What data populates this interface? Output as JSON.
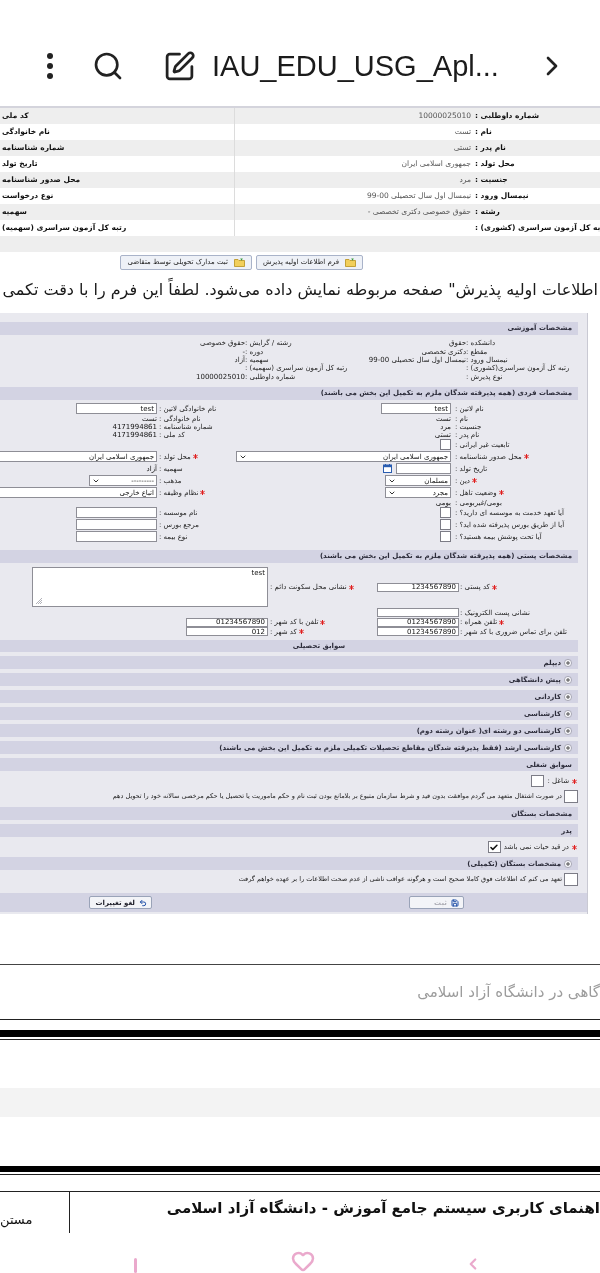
{
  "toolbar": {
    "title": "IAU_EDU_USG_Apl..."
  },
  "summary": {
    "rows": [
      {
        "label": "شماره داوطلبی :",
        "value": "10000025010",
        "side_label": "کد ملی"
      },
      {
        "label": "نام :",
        "value": "تست",
        "side_label": "نام خانوادگی"
      },
      {
        "label": "نام پدر :",
        "value": "تستی",
        "side_label": "شماره شناسنامه"
      },
      {
        "label": "محل تولد :",
        "value": "جمهوری اسلامی ایران",
        "side_label": "تاریخ تولد"
      },
      {
        "label": "جنسیت :",
        "value": "مرد",
        "side_label": "محل صدور شناسنامه"
      },
      {
        "label": "نیمسال ورود :",
        "value": "نیمسال اول سال تحصیلی 00-99",
        "side_label": "نوع درخواست"
      },
      {
        "label": "رشته :",
        "value": "حقوق خصوصی دکتری تخصصی -",
        "side_label": "سهمیه"
      },
      {
        "label": "به کل آزمون سراسری (کشوری) :",
        "side_label": "رتبه کل آزمون سراسری (سهمیه)"
      }
    ]
  },
  "actions": [
    {
      "label": "فرم اطلاعات اولیه پذیرش"
    },
    {
      "label": "ثبت مدارک تحویلی توسط متقاضی"
    }
  ],
  "instruction": "اطلاعات اولیه پذیرش\" صفحه مربوطه نمایش داده می‌شود. لطفاً این فرم را با دقت تکمی",
  "form": {
    "blocks": [
      {
        "kind": "section",
        "label": "مشخصات آموزشی"
      },
      {
        "kind": "info",
        "right": [
          {
            "label": "دانشکده :",
            "value": "حقوق"
          },
          {
            "label": "مقطع :",
            "value": "دکتری تخصصی"
          },
          {
            "label": "نیمسال ورود :",
            "value": "نیمسال اول سال تحصیلی 00-99"
          },
          {
            "label": "رتبه کل آزمون سراسری(کشوری) :"
          },
          {
            "label": "نوع پذیرش :"
          }
        ],
        "left": [
          {
            "label": "رشته / گرایش :",
            "value": "حقوق خصوصی"
          },
          {
            "label": "دوره :",
            "value": "-"
          },
          {
            "label": "سهمیه :",
            "value": "آزاد"
          },
          {
            "label": "رتبه کل آزمون سراسری (سهمیه) :"
          },
          {
            "label": "شماره داوطلبی :",
            "value": "10000025010"
          }
        ]
      },
      {
        "kind": "section",
        "label": "مشخصات فردی (همه پذیرفته شدگان ملزم به تکمیل این بخش می باشند)"
      },
      {
        "kind": "fields",
        "rows": [
          {
            "right": {
              "kind": "input",
              "label": "نام لاتین :",
              "required": false,
              "value": "test"
            },
            "left": {
              "kind": "input",
              "label": "نام خانوادگی لاتین :",
              "required": false,
              "value": "test"
            }
          },
          {
            "right": {
              "kind": "text",
              "label": "نام :",
              "required": false,
              "value": "تست"
            },
            "left": {
              "kind": "text",
              "label": "نام خانوادگی :",
              "required": false,
              "value": "تست"
            }
          },
          {
            "right": {
              "kind": "text",
              "label": "جنسیت :",
              "required": false,
              "value": "مرد"
            },
            "left": {
              "kind": "text",
              "label": "شماره شناسنامه :",
              "required": false,
              "value": "4171994861"
            }
          },
          {
            "right": {
              "kind": "text",
              "label": "نام پدر :",
              "required": false,
              "value": "تستی"
            },
            "left": {
              "kind": "text",
              "label": "کد ملی :",
              "required": false,
              "value": "4171994861"
            }
          },
          {
            "right": {
              "kind": "checkbox",
              "label": "تابعیت غیر ایرانی :",
              "required": false,
              "checked": false
            }
          },
          {
            "right": {
              "kind": "wide_select",
              "label": "محل صدور شناسنامه :",
              "required": true,
              "value": "جمهوری اسلامی ایران"
            },
            "left": {
              "kind": "wide_input",
              "label": "محل تولد :",
              "required": true,
              "value": "جمهوری اسلامی ایران"
            }
          },
          {
            "right": {
              "kind": "date",
              "label": "تاریخ تولد :",
              "required": false
            },
            "left": {
              "kind": "text",
              "label": "سهمیه :",
              "required": false,
              "value": "آزاد"
            }
          },
          {
            "right": {
              "kind": "select",
              "label": "دین :",
              "required": true,
              "value": "مسلمان"
            },
            "left": {
              "kind": "select",
              "label": "مذهب :",
              "required": false,
              "value": "---------"
            }
          },
          {
            "right": {
              "kind": "select",
              "label": "وضعیت تاهل :",
              "required": true,
              "value": "مجرد"
            },
            "left": {
              "kind": "wide_input",
              "label": "نظام وظیفه :",
              "required": true,
              "value": "اتباع خارجی"
            }
          },
          {
            "right": {
              "kind": "text",
              "label": "بومی/غیربومی :",
              "required": false,
              "value": "بومی"
            }
          },
          {
            "right": {
              "kind": "checkbox",
              "label": "آیا تعهد خدمت به موسسه ای دارید؟ :",
              "required": false,
              "checked": false
            },
            "left": {
              "kind": "input",
              "label": "نام موسسه :",
              "required": false
            }
          },
          {
            "right": {
              "kind": "checkbox",
              "label": "آیا از طریق بورس پذیرفته شده اید؟ :",
              "required": false,
              "checked": false
            },
            "left": {
              "kind": "input",
              "label": "مرجع بورس :",
              "required": false
            }
          },
          {
            "right": {
              "kind": "checkbox",
              "label": "آیا تحت پوشش بیمه هستید؟ :",
              "required": false,
              "checked": false
            },
            "left": {
              "kind": "input",
              "label": "نوع بیمه :",
              "required": false
            }
          }
        ]
      },
      {
        "kind": "section",
        "label": "مشخصات پستی (همه پذیرفته شدگان ملزم به تکمیل این بخش می باشند)"
      },
      {
        "kind": "postal",
        "rows": [
          {
            "right": {
              "kind": "input",
              "label": "کد پستی :",
              "required": true,
              "value": "1234567890"
            },
            "left": {
              "kind": "textarea",
              "label": "نشانی محل سکونت دائم :",
              "required": true,
              "value": "test"
            }
          },
          {
            "right": {
              "kind": "input",
              "label": "نشانی پست الکترونیک :",
              "required": false
            }
          },
          {
            "right": {
              "kind": "input",
              "label": "تلفن همراه :",
              "required": true,
              "value": "01234567890"
            },
            "left": {
              "kind": "input",
              "label": "تلفن با کد شهر :",
              "required": true,
              "value": "01234567890"
            }
          },
          {
            "right": {
              "kind": "input",
              "label": "تلفن برای تماس ضروری با کد شهر :",
              "required": false,
              "value": "01234567890"
            },
            "left": {
              "kind": "input",
              "label": "کد شهر :",
              "required": true,
              "value": "012"
            }
          }
        ]
      },
      {
        "kind": "section_center",
        "label": "سوابق تحصیلی"
      },
      {
        "kind": "collapsible",
        "label": "دیپلم",
        "expanded": false
      },
      {
        "kind": "collapsible",
        "label": "پیش دانشگاهی",
        "expanded": false
      },
      {
        "kind": "collapsible",
        "label": "کاردانی",
        "expanded": false
      },
      {
        "kind": "collapsible",
        "label": "کارشناسی",
        "expanded": false
      },
      {
        "kind": "collapsible",
        "label": "کارشناسی دو رشته ای( عنوان رشته دوم)",
        "expanded": false
      },
      {
        "kind": "collapsible",
        "label": "کارشناسی ارشد (فقط پذیرفته شدگان مقاطع تحصیلات تکمیلی ملزم به تکمیل این بخش می باشند)",
        "expanded": false
      },
      {
        "kind": "section",
        "label": "سوابق شغلی"
      },
      {
        "kind": "checkbox_field",
        "label": "شاغل :",
        "required": true,
        "checked": false
      },
      {
        "kind": "agreement",
        "text": "در صورت اشتغال متعهد می گردم موافقت بدون قید و شرط سازمان متبوع بر بلامانع بودن ثبت نام و حکم ماموریت یا تحصیل یا حکم مرخصی سالانه خود را تحویل دهم",
        "checked": false
      },
      {
        "kind": "section",
        "label": "مشخصات بستگان"
      },
      {
        "kind": "section",
        "label": "پدر"
      },
      {
        "kind": "checkbox_field",
        "label": "در قید حیات نمی باشد",
        "required": true,
        "checked": true
      },
      {
        "kind": "collapsible",
        "label": "مشخصات بستگان (تکمیلی)",
        "expanded": false
      },
      {
        "kind": "agreement",
        "text": "تعهد می کنم که اطلاعات فوق کاملا صحیح است و هرگونه عواقب ناشی از عدم صحت اطلاعات را بر عهده خواهم گرفت",
        "checked": false
      },
      {
        "kind": "buttons",
        "buttons": [
          {
            "kind": "save",
            "label": "ثبت",
            "disabled": true
          },
          {
            "kind": "undo",
            "label": "لغو تغییرات",
            "disabled": false
          }
        ]
      }
    ]
  },
  "article": {
    "subtitle": "گاهی در دانشگاه آزاد اسلامی",
    "table": {
      "title": "اهنمای کاربری سیستم جامع آموزش - دانشگاه آزاد اسلامی",
      "column_2": "مستن"
    }
  }
}
